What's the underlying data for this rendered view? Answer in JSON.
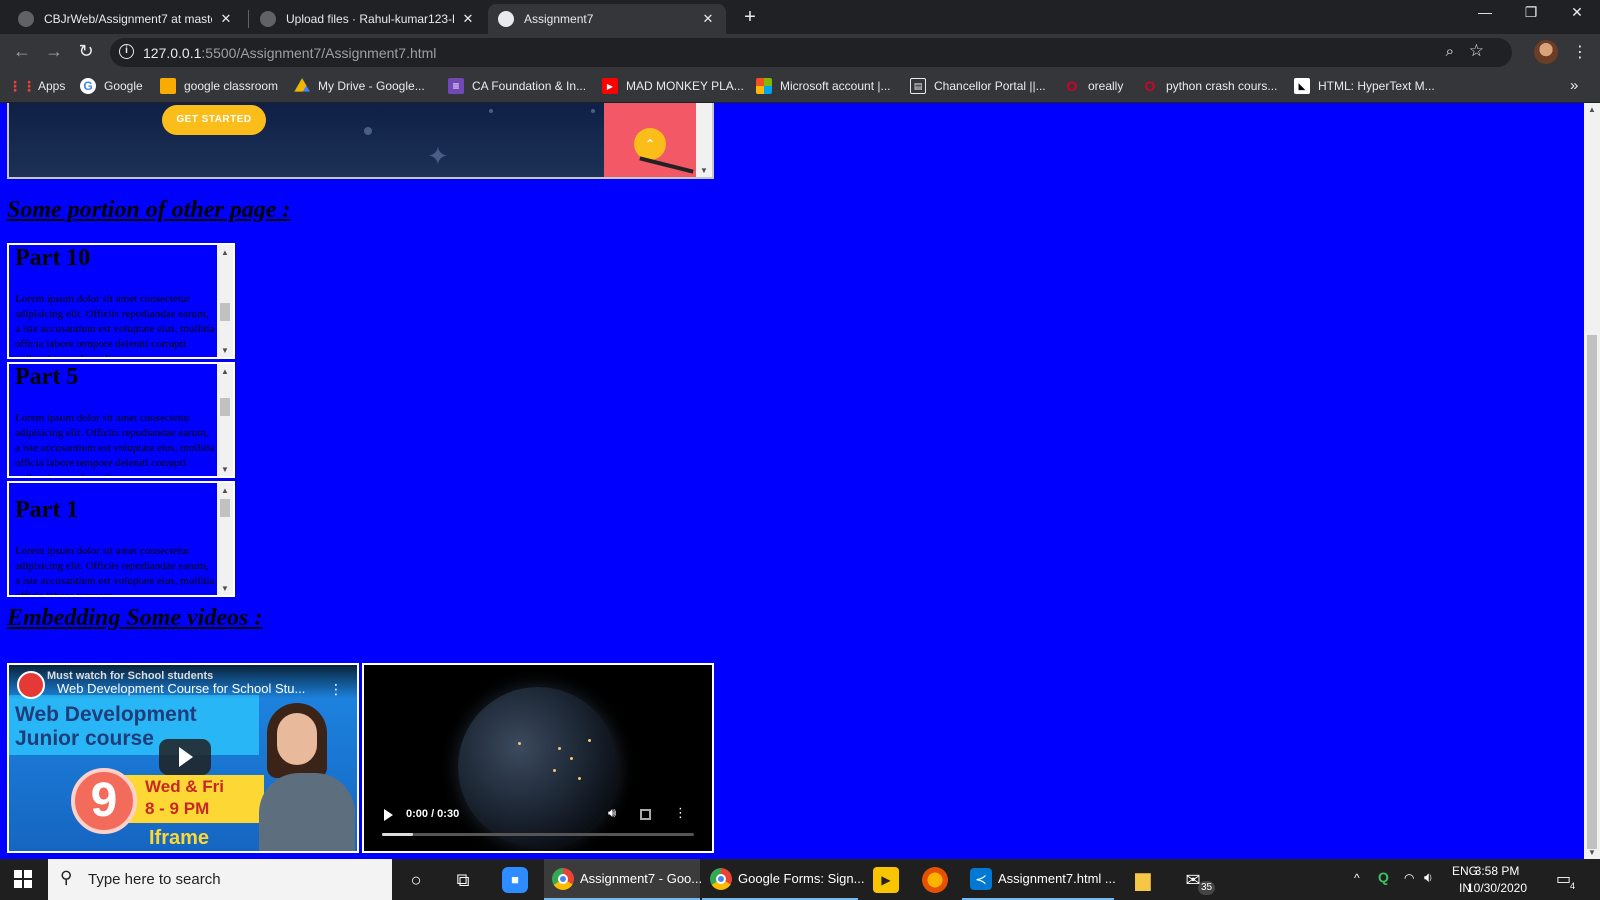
{
  "browser": {
    "tabs": [
      {
        "title": "CBJrWeb/Assignment7 at master",
        "active": false
      },
      {
        "title": "Upload files · Rahul-kumar123-b",
        "active": false
      },
      {
        "title": "Assignment7",
        "active": true
      }
    ],
    "new_tab": "+",
    "window_controls": {
      "minimize": "—",
      "restore": "❐",
      "close": "✕"
    },
    "address": {
      "host": "127.0.0.1",
      "path": ":5500/Assignment7/Assignment7.html",
      "info": "i"
    },
    "bookmarks": [
      {
        "label": "Apps",
        "icon": "apps-grid-icon"
      },
      {
        "label": "Google",
        "icon": "google-icon"
      },
      {
        "label": "google classroom",
        "icon": "classroom-icon"
      },
      {
        "label": "My Drive - Google...",
        "icon": "drive-icon"
      },
      {
        "label": "CA Foundation & In...",
        "icon": "forms-icon"
      },
      {
        "label": "MAD MONKEY PLA...",
        "icon": "youtube-icon"
      },
      {
        "label": "Microsoft account |...",
        "icon": "microsoft-icon"
      },
      {
        "label": "Chancellor Portal ||...",
        "icon": "portal-icon"
      },
      {
        "label": "oreally",
        "icon": "oreilly-icon"
      },
      {
        "label": "python crash cours...",
        "icon": "oreilly-icon"
      },
      {
        "label": "HTML: HyperText M...",
        "icon": "mdn-icon"
      }
    ],
    "bookmarks_more": "»"
  },
  "page": {
    "top_frame": {
      "button": "GET STARTED"
    },
    "heading_other_page": "Some portion of other page :",
    "parts": [
      {
        "title": "Part 10",
        "text": "Lorem ipsum dolor sit amet consectetur adipisicing elit. Officiis repudiandae earum, a iste accusantium est voluptate eius, mollitia officia labore tempore deleniti corrupti quibusdam perferendis."
      },
      {
        "title": "Part 5",
        "text": "Lorem ipsum dolor sit amet consectetur adipisicing elit. Officiis repudiandae earum, a iste accusantium est voluptate eius, mollitia officia labore tempore deleniti corrupti quibusdam perferendis."
      },
      {
        "title": "Part 1",
        "text": "Lorem ipsum dolor sit amet consectetur adipisicing elit. Officiis repudiandae earum, a iste accusantium est voluptate eius, mollitia officia labore tempore."
      }
    ],
    "heading_videos": "Embedding Some videos :",
    "youtube": {
      "channel_title": "Must watch for School students",
      "video_title": "Web Development Course for School Stu...",
      "banner_line1": "Web Development",
      "banner_line2": "Junior course",
      "number": "9",
      "days": "Wed & Fri",
      "time": "8 - 9 PM",
      "label": "Iframe"
    },
    "video": {
      "timecode": "0:00 / 0:30",
      "progress": 0.1
    }
  },
  "taskbar": {
    "search_placeholder": "Type here to search",
    "apps": [
      {
        "label": "Assignment7 - Goo...",
        "state": "active"
      },
      {
        "label": "Google Forms: Sign...",
        "state": "open"
      },
      {
        "label": "Assignment7.html ...",
        "state": "open"
      }
    ],
    "mail_badge": "35",
    "language": "ENG",
    "region": "IN",
    "time": "3:58 PM",
    "date": "10/30/2020",
    "notifications": "4"
  },
  "colors": {
    "page_background": "#0000ff",
    "chrome_dark": "#202124",
    "taskbar": "#1f1f1f"
  }
}
